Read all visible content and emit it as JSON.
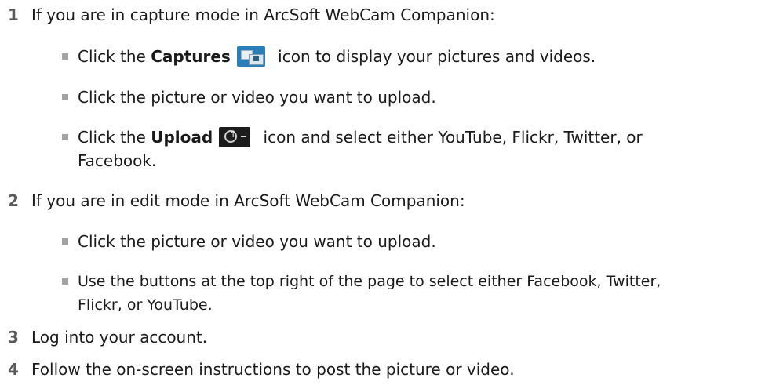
{
  "steps": [
    {
      "num": "1",
      "text": "If you are in capture mode in ArcSoft WebCam Companion:",
      "bullets": [
        {
          "pre": "Click the ",
          "bold": "Captures",
          "icon": "captures-icon",
          "post": " icon to display your pictures and videos."
        },
        {
          "text": "Click the picture or video you want to upload."
        },
        {
          "pre": "Click the ",
          "bold": "Upload",
          "icon": "upload-icon",
          "post": " icon and select either YouTube, Flickr, Twitter, or",
          "line2": "Facebook."
        }
      ]
    },
    {
      "num": "2",
      "text": "If you are in edit mode in ArcSoft WebCam Companion:",
      "bullets": [
        {
          "text": "Click the picture or video you want to upload."
        },
        {
          "text": "Use the buttons at the top right of the page to select either Facebook, Twitter,",
          "line2": "Flickr, or YouTube."
        }
      ]
    },
    {
      "num": "3",
      "text": "Log into your account."
    },
    {
      "num": "4",
      "text": "Follow the on-screen instructions to post the picture or video."
    }
  ],
  "colors": {
    "text": "#1a1a1a",
    "step_number": "#5a5a5a",
    "bullet": "#a3a3a3",
    "captures_icon": "#2b7fb8",
    "upload_icon": "#1c1c1c"
  }
}
